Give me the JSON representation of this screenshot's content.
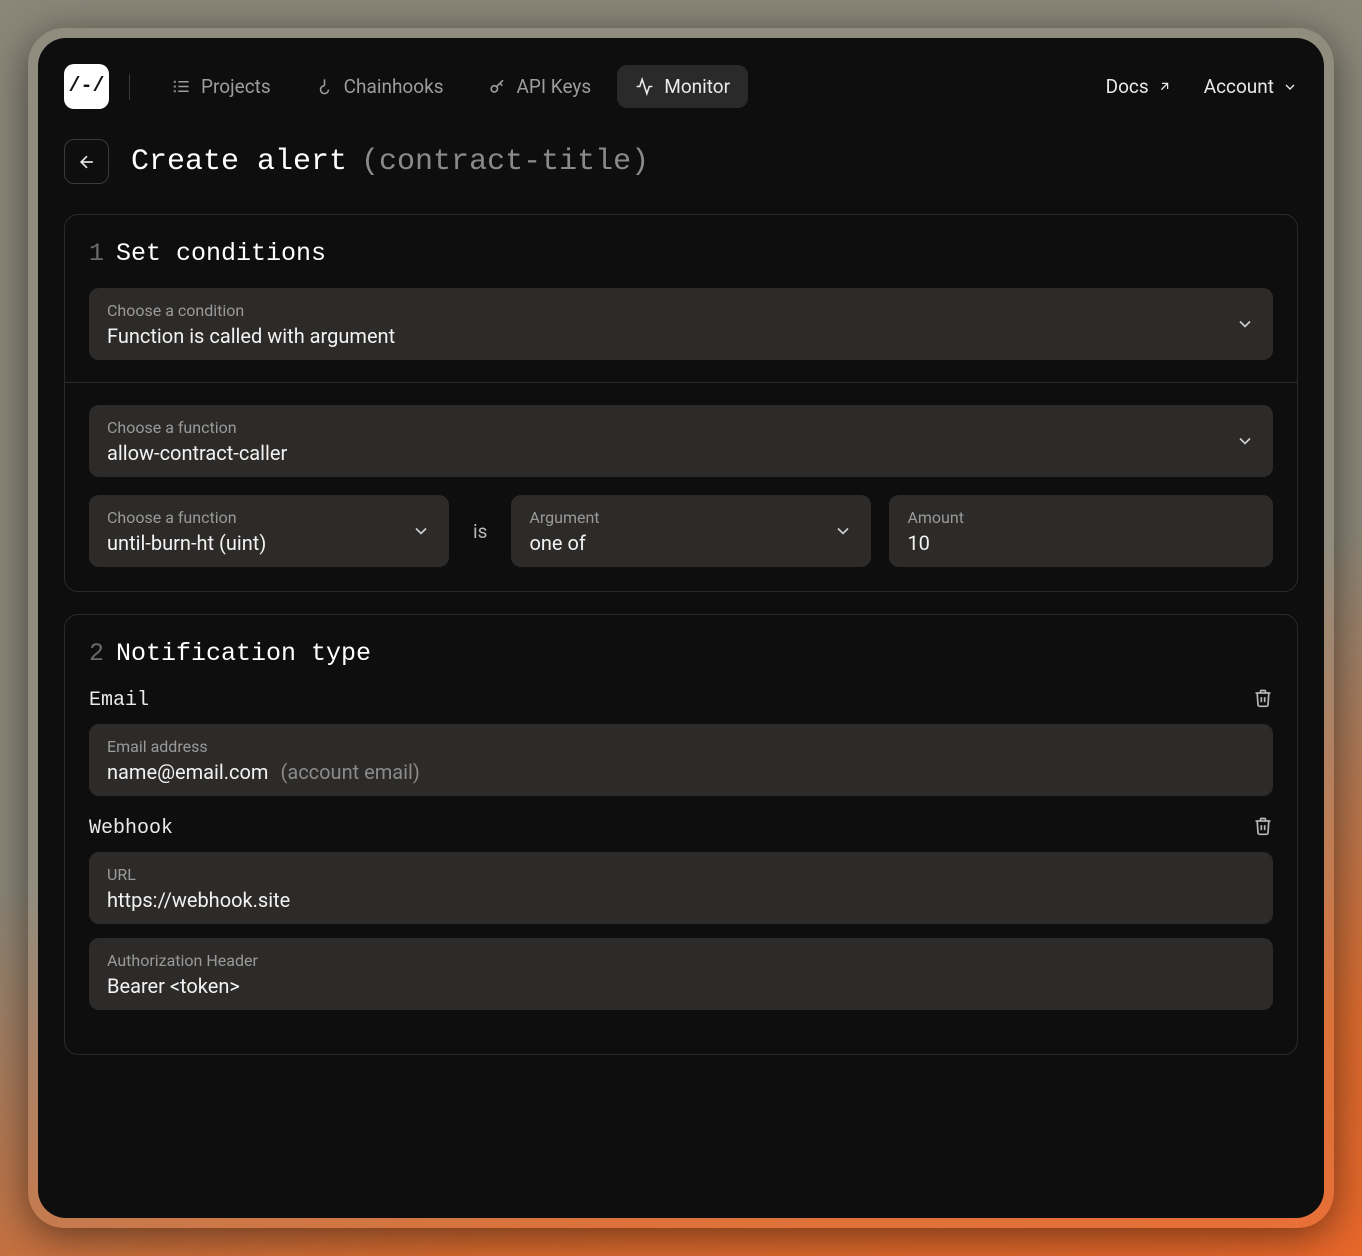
{
  "nav": {
    "logo": "/-/",
    "items": [
      {
        "label": "Projects",
        "icon": "list"
      },
      {
        "label": "Chainhooks",
        "icon": "hook"
      },
      {
        "label": "API Keys",
        "icon": "key"
      },
      {
        "label": "Monitor",
        "icon": "activity",
        "active": true
      }
    ],
    "docs": "Docs",
    "account": "Account"
  },
  "header": {
    "title": "Create alert",
    "subtitle": "(contract-title)"
  },
  "sections": {
    "conditions": {
      "num": "1",
      "title": "Set conditions",
      "condition_label": "Choose a condition",
      "condition_value": "Function is called with argument",
      "function_label": "Choose a function",
      "function_value": "allow-contract-caller",
      "param_label": "Choose a function",
      "param_value": "until-burn-ht (uint)",
      "is": "is",
      "argument_label": "Argument",
      "argument_value": "one of",
      "amount_label": "Amount",
      "amount_value": "10"
    },
    "notification": {
      "num": "2",
      "title": "Notification type",
      "email": {
        "name": "Email",
        "addr_label": "Email address",
        "addr_value": "name@email.com",
        "addr_hint": "(account email)"
      },
      "webhook": {
        "name": "Webhook",
        "url_label": "URL",
        "url_value": "https://webhook.site",
        "auth_label": "Authorization Header",
        "auth_value": "Bearer <token>"
      }
    }
  }
}
